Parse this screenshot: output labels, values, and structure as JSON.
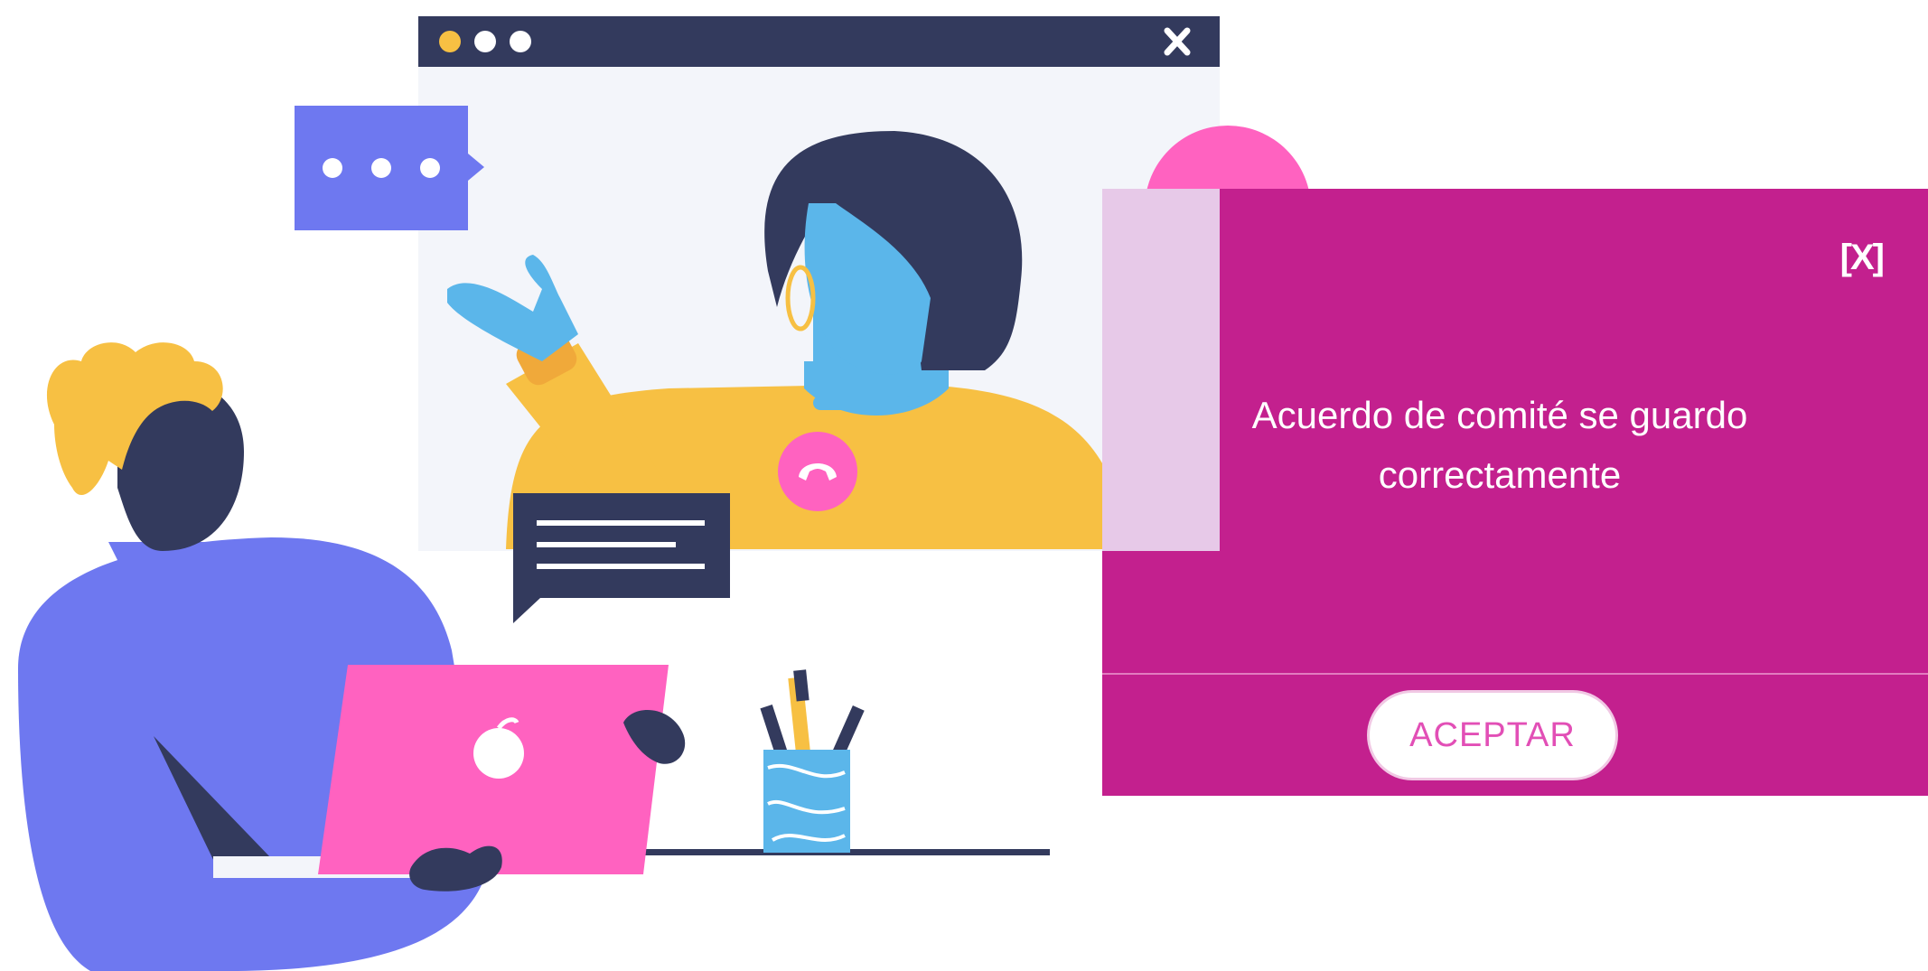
{
  "colors": {
    "modal_bg": "#c3208e",
    "accent_pink": "#ff62c0",
    "navy": "#333a5d",
    "periwinkle": "#6e78f0",
    "mustard": "#f7c043",
    "sky": "#5bb6ea"
  },
  "modal": {
    "close_label": "[X]",
    "message": "Acuerdo de comité se guardo correctamente",
    "accept_label": "ACEPTAR",
    "icon": "lightbulb-icon"
  },
  "illustration": {
    "window_close_icon": "close-icon",
    "window_dots_icon": "window-dots-icon",
    "typing_bubble_icon": "typing-bubble-icon",
    "chat_bubble_icon": "chat-bubble-icon",
    "hangup_icon": "phone-hangup-icon"
  }
}
